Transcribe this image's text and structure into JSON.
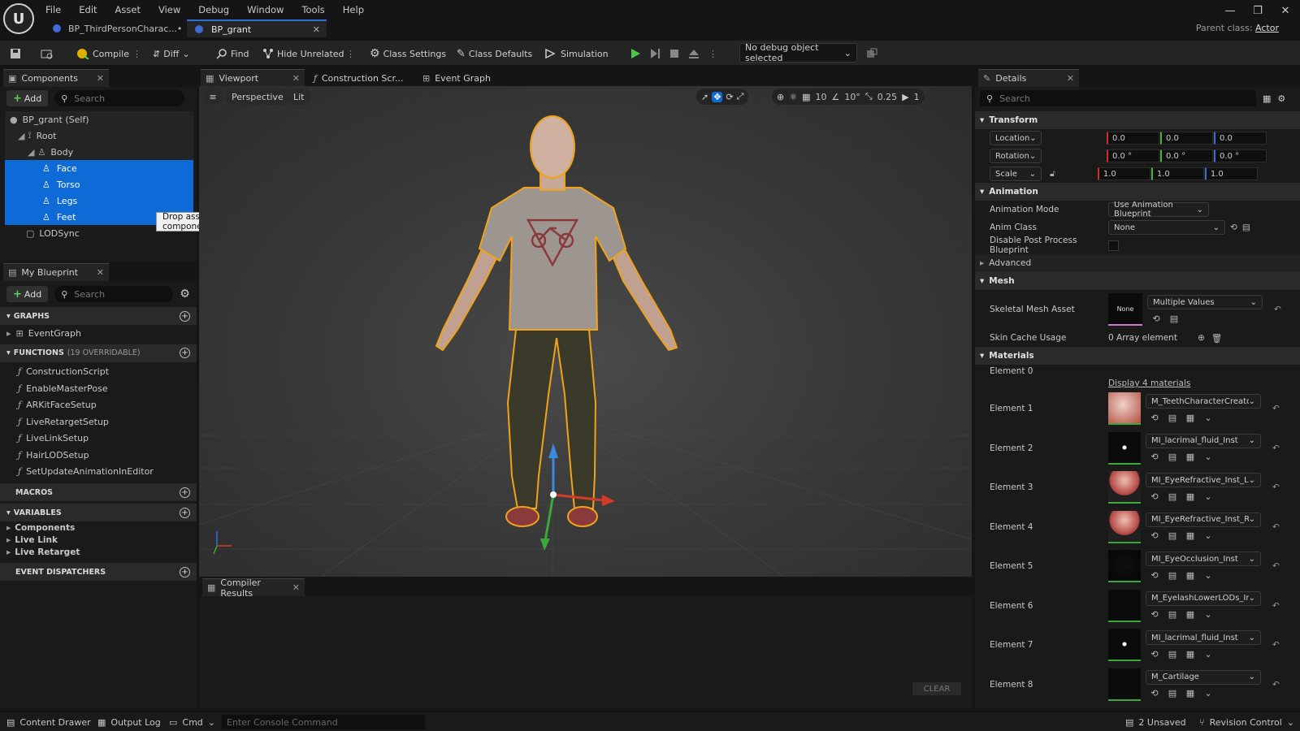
{
  "menu": [
    "File",
    "Edit",
    "Asset",
    "View",
    "Debug",
    "Window",
    "Tools",
    "Help"
  ],
  "doc_tabs": [
    {
      "label": "BP_ThirdPersonCharac...•"
    },
    {
      "label": "BP_grant"
    }
  ],
  "parent_class": {
    "label": "Parent class:",
    "value": "Actor"
  },
  "toolbar": {
    "compile": "Compile",
    "diff": "Diff",
    "find": "Find",
    "hide_unrelated": "Hide Unrelated",
    "class_settings": "Class Settings",
    "class_defaults": "Class Defaults",
    "simulation": "Simulation",
    "debug_object": "No debug object selected"
  },
  "components": {
    "tab": "Components",
    "add": "Add",
    "search_placeholder": "Search",
    "tree": [
      "BP_grant (Self)",
      "Root",
      "Body",
      "Face",
      "Torso",
      "Legs",
      "Feet",
      "LODSync"
    ],
    "tooltip": "Drop asset here to add a component."
  },
  "my_blueprint": {
    "tab": "My Blueprint",
    "add": "Add",
    "search_placeholder": "Search",
    "graphs_label": "GRAPHS",
    "event_graph": "EventGraph",
    "functions_label": "FUNCTIONS",
    "functions_note": "(19 OVERRIDABLE)",
    "functions": [
      "ConstructionScript",
      "EnableMasterPose",
      "ARKitFaceSetup",
      "LiveRetargetSetup",
      "LiveLinkSetup",
      "HairLODSetup",
      "SetUpdateAnimationInEditor"
    ],
    "macros_label": "MACROS",
    "variables_label": "VARIABLES",
    "variables": [
      "Components",
      "Live Link",
      "Live Retarget"
    ],
    "dispatchers_label": "EVENT DISPATCHERS"
  },
  "editor_tabs": {
    "viewport": "Viewport",
    "construction": "Construction Scr...",
    "event_graph": "Event Graph"
  },
  "viewport": {
    "perspective": "Perspective",
    "lit": "Lit",
    "grid": "10",
    "angle": "10°",
    "scale": "0.25",
    "camera": "1"
  },
  "compiler": {
    "tab": "Compiler Results",
    "clear": "CLEAR"
  },
  "details": {
    "tab": "Details",
    "search_placeholder": "Search",
    "transform_label": "Transform",
    "location": {
      "label": "Location",
      "x": "0.0",
      "y": "0.0",
      "z": "0.0"
    },
    "rotation": {
      "label": "Rotation",
      "x": "0.0 °",
      "y": "0.0 °",
      "z": "0.0 °"
    },
    "scale": {
      "label": "Scale",
      "x": "1.0",
      "y": "1.0",
      "z": "1.0"
    },
    "animation_label": "Animation",
    "anim_mode_label": "Animation Mode",
    "anim_mode_value": "Use Animation Blueprint",
    "anim_class_label": "Anim Class",
    "anim_class_value": "None",
    "disable_pp_label": "Disable Post Process Blueprint",
    "advanced_label": "Advanced",
    "mesh_label": "Mesh",
    "skeletal_label": "Skeletal Mesh Asset",
    "skeletal_thumb": "None",
    "skeletal_value": "Multiple Values",
    "skin_cache_label": "Skin Cache Usage",
    "skin_cache_value": "0 Array element",
    "materials_label": "Materials",
    "element0": "Element 0",
    "display_materials": "Display 4 materials",
    "elements": [
      {
        "label": "Element 1",
        "value": "M_TeethCharacterCreator_Inst"
      },
      {
        "label": "Element 2",
        "value": "MI_lacrimal_fluid_Inst"
      },
      {
        "label": "Element 3",
        "value": "MI_EyeRefractive_Inst_L"
      },
      {
        "label": "Element 4",
        "value": "MI_EyeRefractive_Inst_R"
      },
      {
        "label": "Element 5",
        "value": "MI_EyeOcclusion_Inst"
      },
      {
        "label": "Element 6",
        "value": "M_EyelashLowerLODs_Inst"
      },
      {
        "label": "Element 7",
        "value": "MI_lacrimal_fluid_Inst"
      },
      {
        "label": "Element 8",
        "value": "M_Cartilage"
      }
    ]
  },
  "statusbar": {
    "content_drawer": "Content Drawer",
    "output_log": "Output Log",
    "cmd": "Cmd",
    "console_placeholder": "Enter Console Command",
    "unsaved": "2 Unsaved",
    "revision": "Revision Control"
  },
  "colors": {
    "accent": "#0e6ad6",
    "selection": "#0e6ad6",
    "play": "#4cc64c",
    "outline": "#f0a21a"
  }
}
